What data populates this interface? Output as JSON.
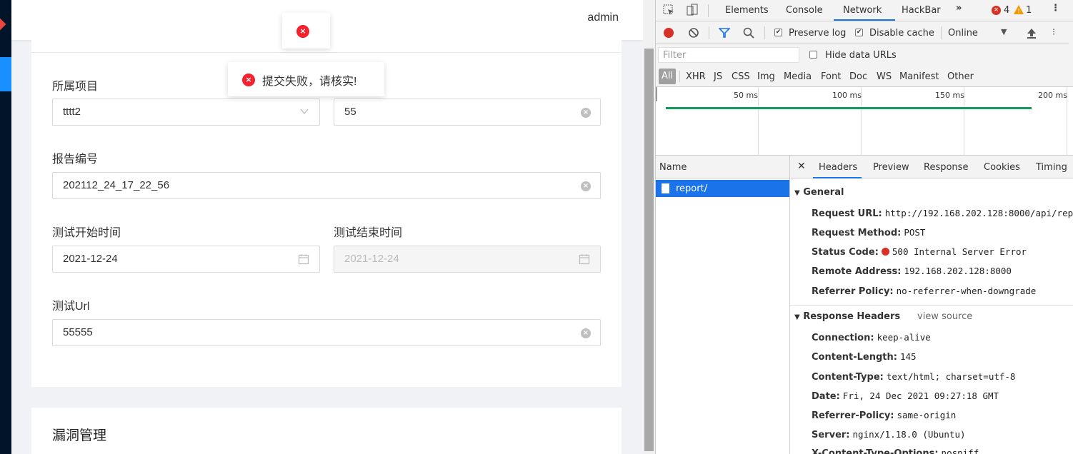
{
  "app": {
    "user": "admin",
    "toast_message": "提交失败，请核实!"
  },
  "form": {
    "project_label": "所属项目",
    "project_value": "tttt2",
    "field2_value": "55",
    "report_no_label": "报告编号",
    "report_no_value": "202112_24_17_22_56",
    "start_label": "测试开始时间",
    "start_value": "2021-12-24",
    "end_label": "测试结束时间",
    "end_value": "2021-12-24",
    "url_label": "测试Url",
    "url_value": "55555"
  },
  "vuln_section": {
    "title": "漏洞管理"
  },
  "devtools": {
    "tabs": [
      "Elements",
      "Console",
      "Network",
      "HackBar"
    ],
    "active_tab": "Network",
    "errors_count": "4",
    "warnings_count": "1",
    "toolbar": {
      "preserve_log": "Preserve log",
      "disable_cache": "Disable cache",
      "throttle": "Online"
    },
    "filter_placeholder": "Filter",
    "hide_data_urls": "Hide data URLs",
    "types": [
      "All",
      "XHR",
      "JS",
      "CSS",
      "Img",
      "Media",
      "Font",
      "Doc",
      "WS",
      "Manifest",
      "Other"
    ],
    "timeline_ticks": [
      "50 ms",
      "100 ms",
      "150 ms",
      "200 ms"
    ],
    "name_header": "Name",
    "request_name": "report/",
    "detail_tabs": [
      "Headers",
      "Preview",
      "Response",
      "Cookies",
      "Timing"
    ],
    "general": {
      "title": "General",
      "rows": [
        {
          "k": "Request URL:",
          "v": "http://192.168.202.128:8000/api/rep"
        },
        {
          "k": "Request Method:",
          "v": "POST"
        },
        {
          "k": "Status Code:",
          "v": "500 Internal Server Error"
        },
        {
          "k": "Remote Address:",
          "v": "192.168.202.128:8000"
        },
        {
          "k": "Referrer Policy:",
          "v": "no-referrer-when-downgrade"
        }
      ]
    },
    "response_headers": {
      "title": "Response Headers",
      "view_source": "view source",
      "rows": [
        {
          "k": "Connection:",
          "v": "keep-alive"
        },
        {
          "k": "Content-Length:",
          "v": "145"
        },
        {
          "k": "Content-Type:",
          "v": "text/html; charset=utf-8"
        },
        {
          "k": "Date:",
          "v": "Fri, 24 Dec 2021 09:27:18 GMT"
        },
        {
          "k": "Referrer-Policy:",
          "v": "same-origin"
        },
        {
          "k": "Server:",
          "v": "nginx/1.18.0 (Ubuntu)"
        },
        {
          "k": "X-Content-Type-Options:",
          "v": "nosniff"
        }
      ]
    }
  }
}
